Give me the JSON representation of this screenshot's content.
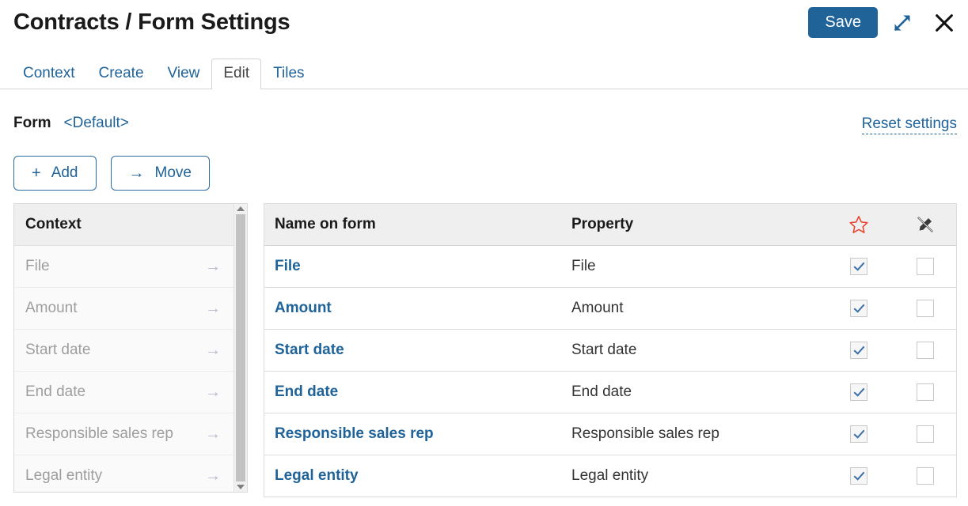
{
  "header": {
    "title": "Contracts / Form Settings",
    "save_label": "Save",
    "expand_icon": "expand-diagonal-icon",
    "close_icon": "close-icon",
    "accent_color": "#1f6399"
  },
  "tabs": [
    {
      "label": "Context",
      "active": false
    },
    {
      "label": "Create",
      "active": false
    },
    {
      "label": "View",
      "active": false
    },
    {
      "label": "Edit",
      "active": true
    },
    {
      "label": "Tiles",
      "active": false
    }
  ],
  "form": {
    "label": "Form",
    "value": "<Default>",
    "reset_label": "Reset settings"
  },
  "toolbar": {
    "add_label": "Add",
    "add_glyph": "+",
    "move_label": "Move",
    "move_glyph": "→"
  },
  "context_panel": {
    "header": "Context",
    "arrow_glyph": "→",
    "items": [
      {
        "label": "File"
      },
      {
        "label": "Amount"
      },
      {
        "label": "Start date"
      },
      {
        "label": "End date"
      },
      {
        "label": "Responsible sales rep"
      },
      {
        "label": "Legal entity"
      }
    ]
  },
  "form_table": {
    "columns": {
      "name": "Name on form",
      "property": "Property",
      "star_icon": "star-outline-icon",
      "pin_icon": "pencil-slash-icon",
      "star_color": "#e8402a",
      "pin_color": "#3a3a3a"
    },
    "rows": [
      {
        "name": "File",
        "property": "File",
        "starred": true,
        "pinned": false
      },
      {
        "name": "Amount",
        "property": "Amount",
        "starred": true,
        "pinned": false
      },
      {
        "name": "Start date",
        "property": "Start date",
        "starred": true,
        "pinned": false
      },
      {
        "name": "End date",
        "property": "End date",
        "starred": true,
        "pinned": false
      },
      {
        "name": "Responsible sales rep",
        "property": "Responsible sales rep",
        "starred": true,
        "pinned": false
      },
      {
        "name": "Legal entity",
        "property": "Legal entity",
        "starred": true,
        "pinned": false
      }
    ]
  }
}
